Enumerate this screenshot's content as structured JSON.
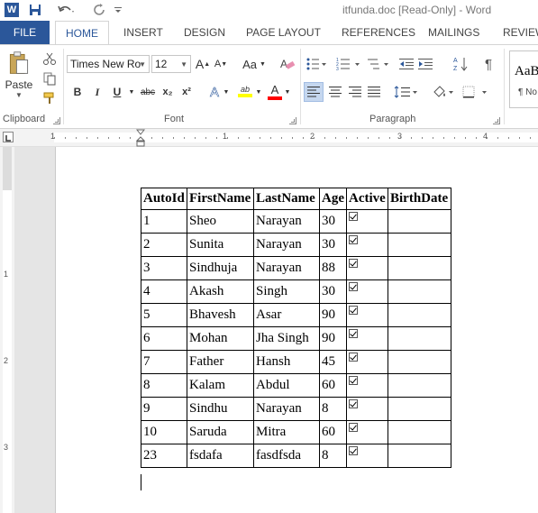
{
  "window": {
    "title": "itfunda.doc [Read-Only] - Word",
    "app_icon": "W"
  },
  "ribbon_tabs": [
    "FILE",
    "HOME",
    "INSERT",
    "DESIGN",
    "PAGE LAYOUT",
    "REFERENCES",
    "MAILINGS",
    "REVIEW"
  ],
  "active_tab": "HOME",
  "clipboard": {
    "paste_label": "Paste",
    "group_label": "Clipboard"
  },
  "font": {
    "name": "Times New Ro",
    "size": "12",
    "group_label": "Font",
    "change_case_label": "Aa",
    "bold": "B",
    "italic": "I",
    "underline": "U",
    "strikethrough": "abc",
    "subscript": "x₂",
    "superscript": "x²",
    "grow": "A",
    "shrink": "A",
    "text_effects": "A",
    "highlight": "ab",
    "font_color": "A",
    "highlight_color": "#ffff00",
    "font_color_value": "#ff0000"
  },
  "paragraph": {
    "group_label": "Paragraph",
    "pilcrow": "¶"
  },
  "styles": {
    "preview": "AaB",
    "name": "¶ No"
  },
  "ruler": {
    "numbers": [
      "1",
      "1",
      "2",
      "3",
      "4"
    ]
  },
  "vruler": {
    "numbers": [
      "1",
      "2",
      "3"
    ]
  },
  "table": {
    "headers": [
      "AutoId",
      "FirstName",
      "LastName",
      "Age",
      "Active",
      "BirthDate"
    ],
    "rows": [
      [
        "1",
        "Sheo",
        "Narayan",
        "30",
        true,
        ""
      ],
      [
        "2",
        "Sunita",
        "Narayan",
        "30",
        true,
        ""
      ],
      [
        "3",
        "Sindhuja",
        "Narayan",
        "88",
        true,
        ""
      ],
      [
        "4",
        "Akash",
        "Singh",
        "30",
        true,
        ""
      ],
      [
        "5",
        "Bhavesh",
        "Asar",
        "90",
        true,
        ""
      ],
      [
        "6",
        "Mohan",
        "Jha Singh",
        "90",
        true,
        ""
      ],
      [
        "7",
        "Father",
        "Hansh",
        "45",
        true,
        ""
      ],
      [
        "8",
        "Kalam",
        "Abdul",
        "60",
        true,
        ""
      ],
      [
        "9",
        "Sindhu",
        "Narayan",
        "8",
        true,
        ""
      ],
      [
        "10",
        "Saruda",
        "Mitra",
        "60",
        true,
        ""
      ],
      [
        "23",
        "fsdafa",
        "fasdfsda",
        "8",
        true,
        ""
      ]
    ]
  },
  "colors": {
    "accent": "#2b579a",
    "align_selected": "#c5d7ef"
  }
}
